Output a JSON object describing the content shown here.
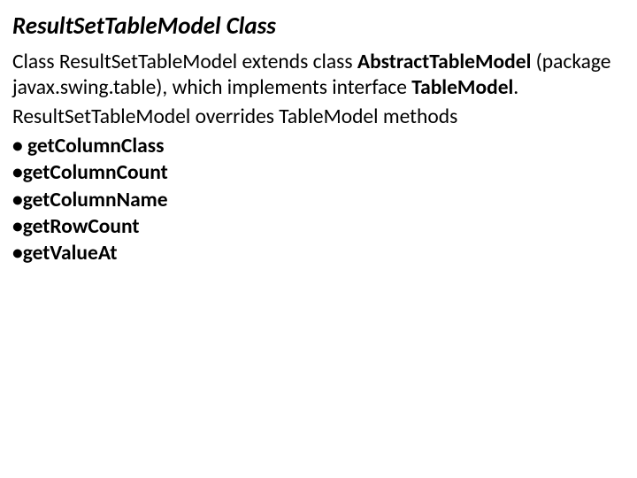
{
  "title": "ResultSetTableModel Class",
  "paragraph1": {
    "t1": "Class ResultSetTableModel extends class ",
    "bold1": "AbstractTableModel",
    "t2": " (package javax.swing.table), which implements interface ",
    "bold2": "TableModel",
    "t3": "."
  },
  "paragraph2": "ResultSetTableModel overrides TableModel methods",
  "methods": {
    "m1": " getColumnClass",
    "m2": "getColumnCount",
    "m3": "getColumnName",
    "m4": "getRowCount",
    "m5": "getValueAt"
  }
}
